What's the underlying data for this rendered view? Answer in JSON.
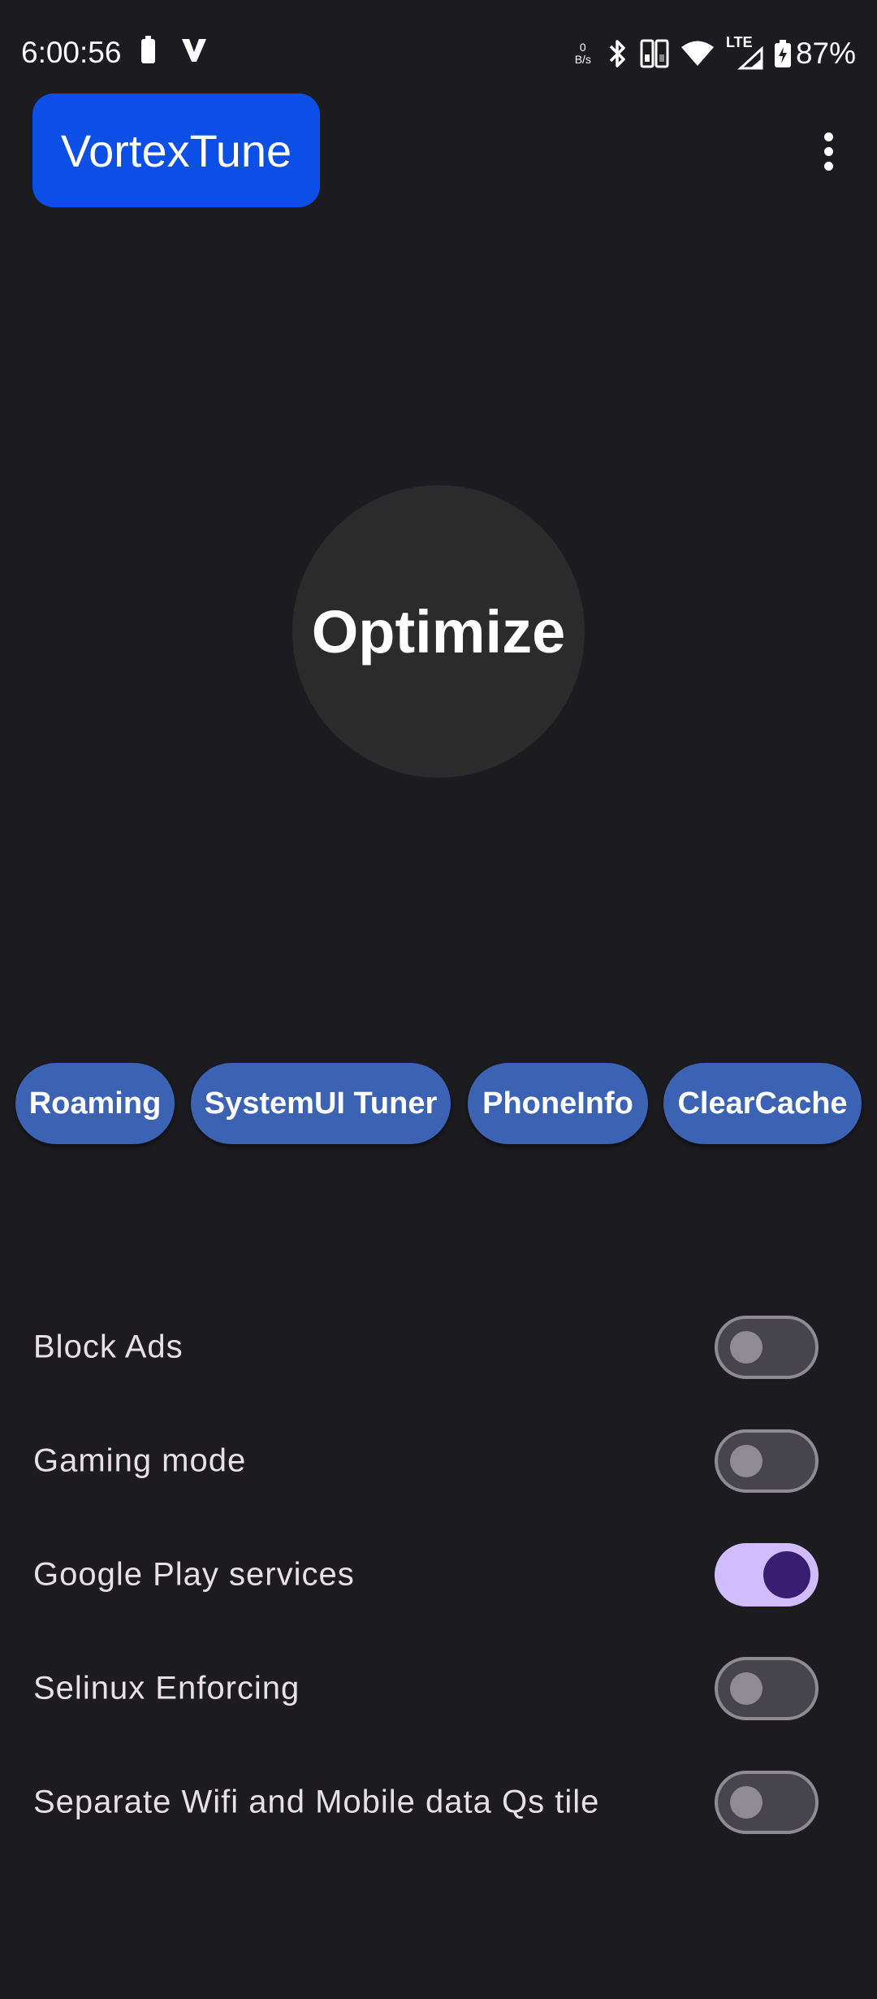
{
  "status_bar": {
    "time": "6:00:56",
    "net_speed_value": "0",
    "net_speed_unit": "B/s",
    "network_type": "LTE",
    "battery_level": "87%",
    "icons": [
      "battery-saver-icon",
      "v-app-icon",
      "bluetooth-icon",
      "dual-sim-icon",
      "wifi-icon",
      "signal-icon",
      "battery-charging-icon"
    ]
  },
  "app_bar": {
    "title": "VortexTune",
    "title_color": "#0b4fe6",
    "menu_icon": "overflow-menu-icon"
  },
  "main": {
    "optimize_label": "Optimize"
  },
  "chips": [
    {
      "label": "Roaming"
    },
    {
      "label": "SystemUI Tuner"
    },
    {
      "label": "PhoneInfo"
    },
    {
      "label": "ClearCache"
    }
  ],
  "chip_color": "#3b62b3",
  "settings": [
    {
      "label": "Block Ads",
      "enabled": false
    },
    {
      "label": "Gaming mode",
      "enabled": false
    },
    {
      "label": "Google Play services",
      "enabled": true
    },
    {
      "label": "Selinux Enforcing",
      "enabled": false
    },
    {
      "label": "Separate Wifi and Mobile data Qs tile",
      "enabled": false
    }
  ],
  "toggle_on_color": "#d0bcff"
}
